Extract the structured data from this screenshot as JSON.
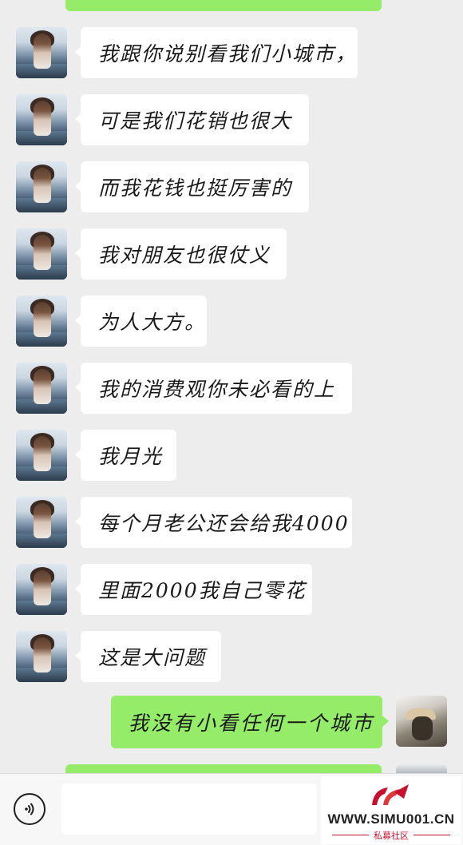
{
  "chat": {
    "incoming_messages": [
      "我跟你说别看我们小城市，",
      "可是我们花销也很大",
      "而我花钱也挺厉害的",
      "我对朋友也很仗义",
      "为人大方。",
      "我的消费观你未必看的上",
      "我月光",
      "每个月老公还会给我4000",
      "里面2000我自己零花",
      "这是大问题"
    ],
    "outgoing_message": "我没有小看任何一个城市"
  },
  "input_bar": {
    "voice_icon": "voice-wave-icon",
    "placeholder": ""
  },
  "watermark": {
    "site": "WWW.SIMU001.CN",
    "subtitle": "私募社区",
    "brand_color": "#c8102e"
  },
  "colors": {
    "background": "#ededed",
    "incoming_bubble": "#ffffff",
    "outgoing_bubble": "#95ec69"
  }
}
